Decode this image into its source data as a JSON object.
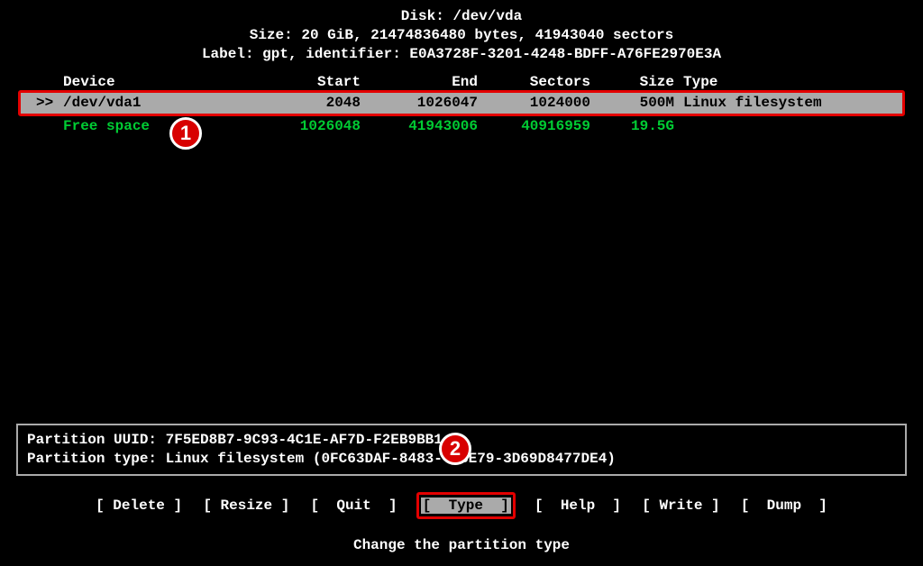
{
  "header": {
    "disk": "Disk: /dev/vda",
    "size": "Size: 20 GiB, 21474836480 bytes, 41943040 sectors",
    "label": "Label: gpt, identifier: E0A3728F-3201-4248-BDFF-A76FE2970E3A"
  },
  "columns": {
    "device": "Device",
    "start": "Start",
    "end": "End",
    "sectors": "Sectors",
    "size": "Size",
    "type": "Type"
  },
  "rows": [
    {
      "marker": ">>",
      "device": "/dev/vda1",
      "start": "2048",
      "end": "1026047",
      "sectors": "1024000",
      "size": "500M",
      "type": "Linux filesystem",
      "selected": true,
      "free": false
    },
    {
      "marker": "",
      "device": "Free space",
      "start": "1026048",
      "end": "41943006",
      "sectors": "40916959",
      "size": "19.5G",
      "type": "",
      "selected": false,
      "free": true
    }
  ],
  "info": {
    "uuid": "Partition UUID: 7F5ED8B7-9C93-4C1E-AF7D-F2EB9BB1",
    "ptype": "Partition type: Linux filesystem (0FC63DAF-8483-     -8E79-3D69D8477DE4)"
  },
  "menu": {
    "delete": "Delete",
    "resize": "Resize",
    "quit": "Quit",
    "type": "Type",
    "help": "Help",
    "write": "Write",
    "dump": "Dump"
  },
  "hint": "Change the partition type",
  "callouts": {
    "one": "1",
    "two": "2"
  }
}
